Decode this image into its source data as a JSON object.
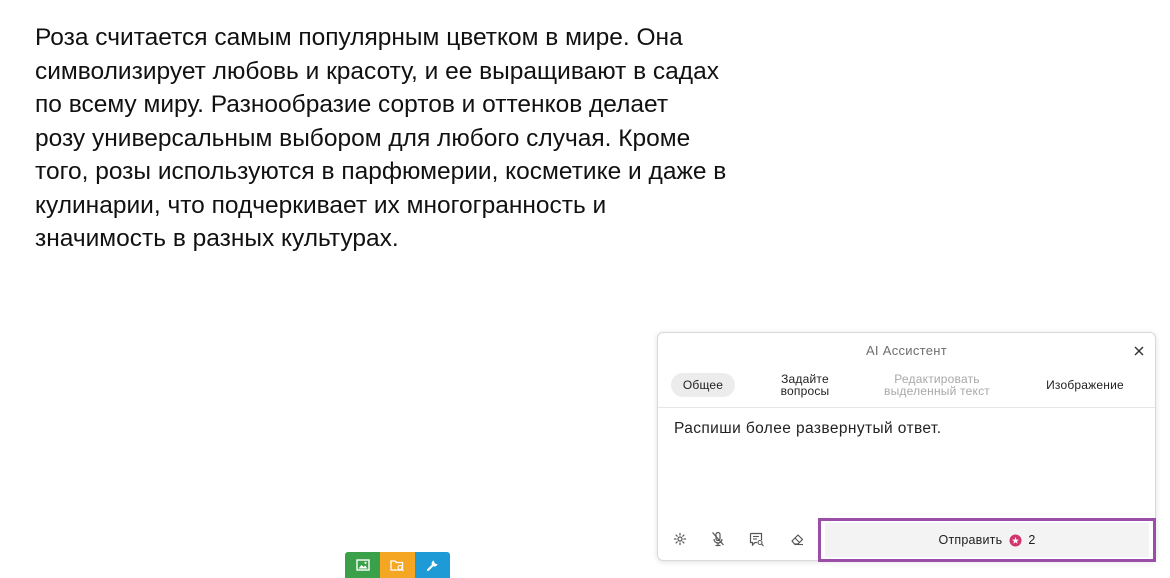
{
  "article": {
    "lines": [
      "Роза считается самым популярным цветком в мире. Она",
      "символизирует любовь и красоту, и ее выращивают в садах",
      "по всему миру. Разнообразие сортов и оттенков делает",
      "розу универсальным выбором для любого случая. Кроме",
      "того, розы используются в парфюмерии, косметике и даже в",
      "кулинарии, что подчеркивает их многогранность и",
      "значимость в разных культурах."
    ]
  },
  "ai_panel": {
    "title": "AI Ассистент",
    "tabs": [
      {
        "line1": "Общее",
        "line2": ""
      },
      {
        "line1": "Задайте",
        "line2": "вопросы"
      },
      {
        "line1": "Редактировать",
        "line2": "выделенный текст"
      },
      {
        "line1": "Изображение",
        "line2": ""
      }
    ],
    "active_tab": "Общее",
    "prompt_text": "Распиши более развернутый ответ.",
    "controls": [
      "gear-icon",
      "mic-off-icon",
      "search-chat-icon",
      "eraser-icon"
    ],
    "send_label": "Отправить",
    "credit_count": "2"
  },
  "mini_toolbar": {
    "buttons": [
      "image-icon",
      "folder-search-icon",
      "wrench-icon"
    ],
    "colors": [
      "#3aa04a",
      "#f5a623",
      "#1e9bd7"
    ]
  },
  "colors": {
    "highlight_border": "#9b4ea8",
    "credit_badge": "#d1356b"
  }
}
